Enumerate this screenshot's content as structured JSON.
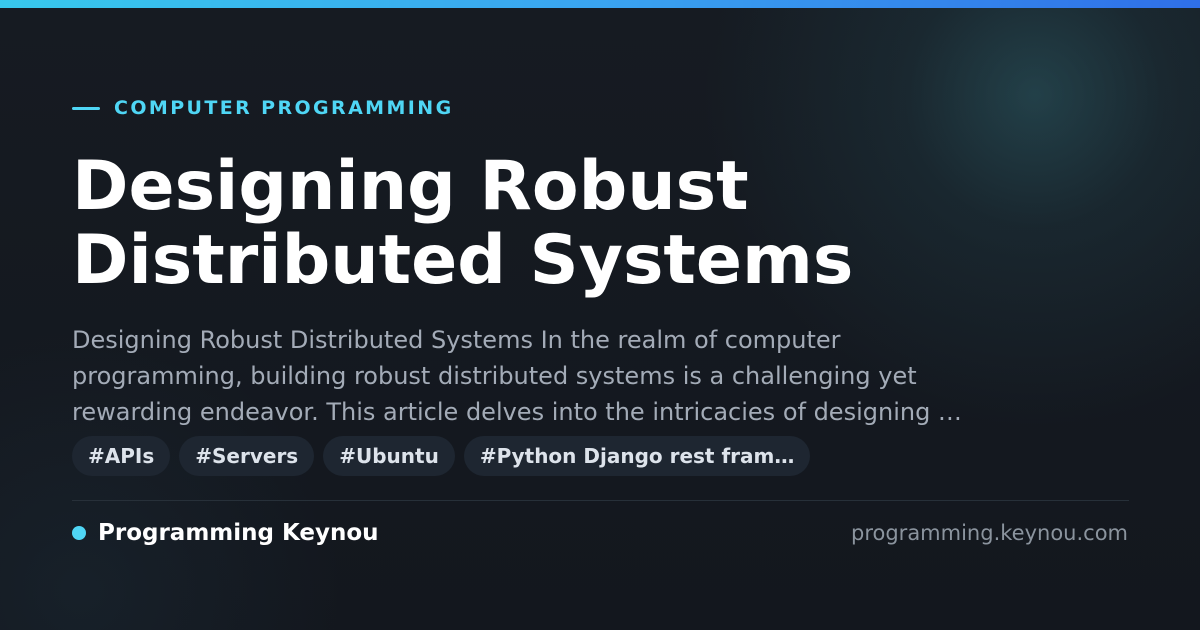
{
  "colors": {
    "accent": "#4fd6f5",
    "top_bar_start": "#38c8ec",
    "top_bar_end": "#2f6fe8",
    "background": "#13171e",
    "tag_background": "#1e2631"
  },
  "category": {
    "label": "COMPUTER PROGRAMMING"
  },
  "title": {
    "lines": [
      "Designing Robust",
      "Distributed Systems"
    ]
  },
  "excerpt": {
    "lines": [
      "Designing Robust Distributed Systems In the realm of computer",
      "programming, building robust distributed systems is a challenging yet",
      "rewarding endeavor. This article delves into the intricacies of designing …"
    ]
  },
  "tags": [
    "#APIs",
    "#Servers",
    "#Ubuntu",
    "#Python Django rest fram…"
  ],
  "footer": {
    "brand_name": "Programming Keynou",
    "domain": "programming.keynou.com"
  }
}
